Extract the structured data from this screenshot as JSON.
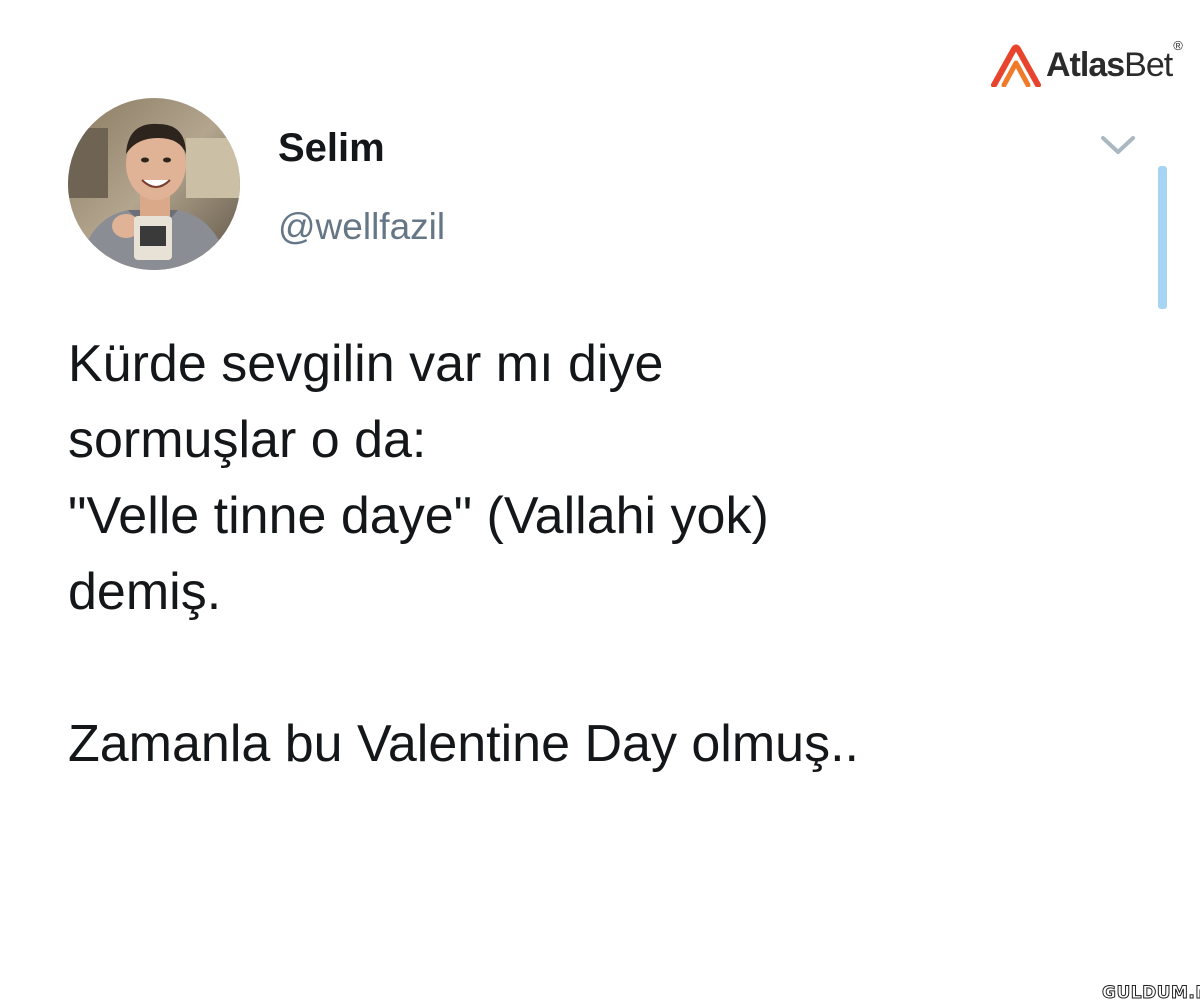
{
  "brand": {
    "name_strong": "Atlas",
    "name_light": "Bet",
    "trademark": "®",
    "accent_color": "#e8432d"
  },
  "tweet": {
    "avatar_icon": "user-avatar-photo",
    "display_name": "Selim",
    "handle": "@wellfazil",
    "menu_icon": "chevron-down-icon",
    "lines": [
      "Kürde sevgilin var mı diye",
      "sormuşlar o da:",
      "\"Velle tinne daye\" (Vallahi yok)",
      "demiş."
    ],
    "closing_line": "Zamanla bu Valentine Day olmuş.."
  },
  "watermark": {
    "site": "GULDUM.NET"
  },
  "colors": {
    "text": "#14171a",
    "secondary_text": "#657786",
    "scroll_indicator": "#a8d4f4"
  }
}
